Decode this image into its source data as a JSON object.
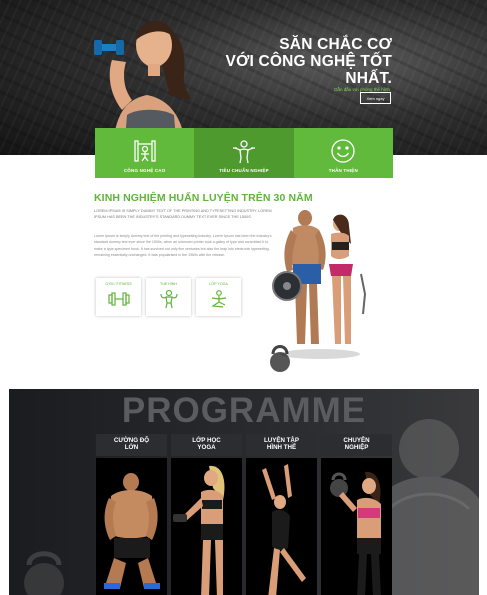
{
  "hero": {
    "title_lines": [
      "SĂN CHẮC CƠ",
      "VỚI CÔNG NGHỆ TỐT",
      "NHẤT."
    ],
    "subtitle": "Dẫn đầu với phòng thể hình",
    "button_label": "Xem ngay"
  },
  "features": [
    {
      "label": "CÔNG NGHỆ CAO",
      "icon": "gym-machine-icon"
    },
    {
      "label": "TIÊU CHUẨN NGHIỆP",
      "icon": "trainer-icon"
    },
    {
      "label": "THÂN THIỆN",
      "icon": "smiley-icon"
    }
  ],
  "experience": {
    "title": "KINH NGHIỆM HUẤN LUYỆN TRÊN 30 NĂM",
    "lead": "LOREM IPSUM IS SIMPLY DUMMY TEXT OF THE PRINTING AND TYPESETTING INDUSTRY. LOREM IPSUM HAS BEEN THE INDUSTRY'S STANDARD DUMMY TEXT EVER SINCE THE 1500S.",
    "body": "Lorem Ipsum is simply dummy text of the printing and typesetting industry. Lorem Ipsum has been the industry's standard dummy text ever since the 1500s, when an unknown printer took a galley of type and scrambled it to make a type specimen book. It has survived not only five centuries but also the leap into electronic typesetting, remaining essentially unchanged. It was popularised in the 1960s with the release.",
    "cards": [
      {
        "label": "GYM / FITNESS",
        "icon": "dumbbell-icon"
      },
      {
        "label": "THỂ HÌNH",
        "icon": "bodybuilder-icon"
      },
      {
        "label": "LỚP YOGA",
        "icon": "yoga-icon"
      }
    ]
  },
  "programme": {
    "title": "PROGRAMME",
    "items": [
      {
        "line1": "CƯỜNG ĐỘ",
        "line2": "LỚN"
      },
      {
        "line1": "LỚP HỌC",
        "line2": "YOGA"
      },
      {
        "line1": "LUYỆN TẬP",
        "line2": "HÌNH THỂ"
      },
      {
        "line1": "CHUYÊN",
        "line2": "NGHIỆP"
      }
    ]
  },
  "colors": {
    "accent": "#62ba3c",
    "accent_dark": "#4e9a2f",
    "hero_bg": "#2e2e2e",
    "programme_bg": "#1e2023"
  }
}
